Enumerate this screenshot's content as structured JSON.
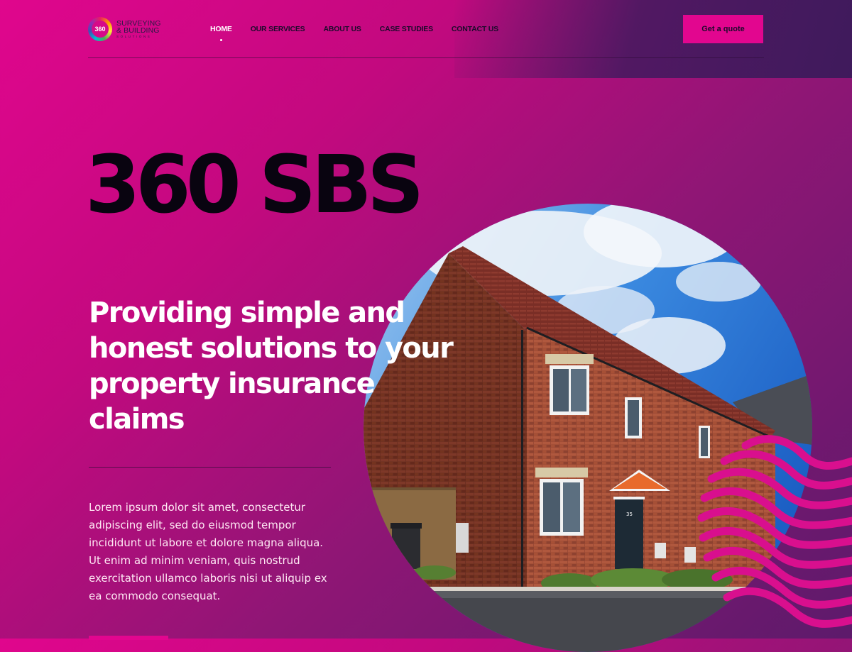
{
  "brand": {
    "logo_mark": "360",
    "logo_line1": "SURVEYING",
    "logo_line2": "& BUILDING",
    "logo_line3": "SOLUTIONS"
  },
  "nav": {
    "items": [
      {
        "label": "HOME",
        "active": true
      },
      {
        "label": "OUR SERVICES",
        "active": false
      },
      {
        "label": "ABOUT US",
        "active": false
      },
      {
        "label": "CASE STUDIES",
        "active": false
      },
      {
        "label": "CONTACT US",
        "active": false
      }
    ],
    "cta_label": "Get a quote"
  },
  "hero": {
    "title": "360 SBS",
    "subtitle": "Providing simple and honest solutions to your property insurance claims",
    "body": "Lorem ipsum dolor sit amet, consectetur adipiscing elit, sed do eiusmod tempor incididunt ut labore et dolore magna aliqua. Ut enim ad minim veniam, quis nostrud exercitation ullamco laboris nisi ut aliquip ex ea commodo consequat.",
    "house_number": "35"
  },
  "colors": {
    "accent": "#e2068f",
    "background_start": "#e0068d",
    "background_end": "#5d1a6b",
    "heading_dark": "#090410"
  }
}
